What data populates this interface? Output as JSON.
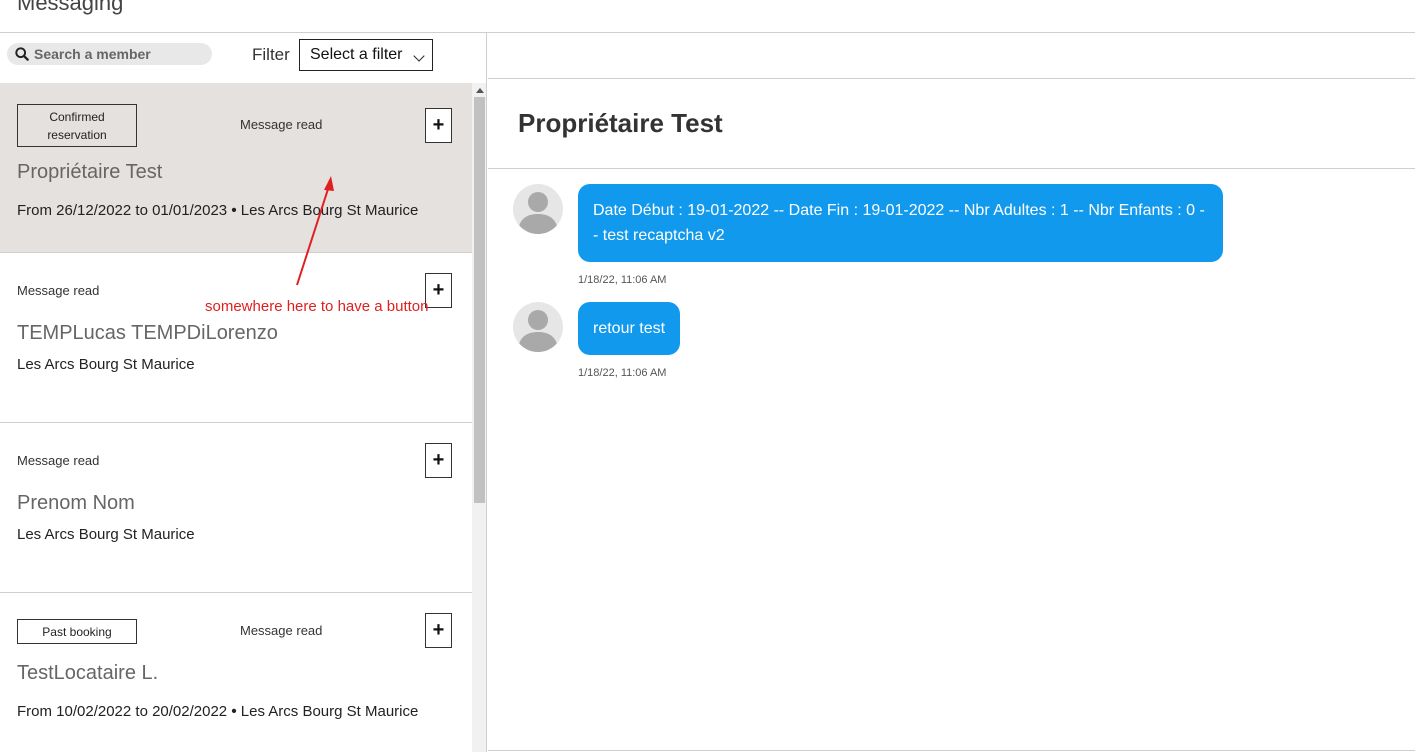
{
  "page": {
    "title": "Messaging"
  },
  "toolbar": {
    "search_placeholder": "Search a member",
    "filter_label": "Filter",
    "filter_value": "Select a filter"
  },
  "conversations": [
    {
      "tag": "Confirmed reservation",
      "status": "Message read",
      "name": "Propriétaire Test",
      "dates": "From 26/12/2022 to 01/01/2023",
      "separator": "•",
      "location": "Les Arcs Bourg St Maurice",
      "selected": true
    },
    {
      "tag": "",
      "status": "Message read",
      "name": "TEMPLucas TEMPDiLorenzo",
      "dates": "",
      "separator": "",
      "location": "Les Arcs Bourg St Maurice",
      "selected": false
    },
    {
      "tag": "",
      "status": "Message read",
      "name": "Prenom Nom",
      "dates": "",
      "separator": "",
      "location": "Les Arcs Bourg St Maurice",
      "selected": false
    },
    {
      "tag": "Past booking",
      "status": "Message read",
      "name": "TestLocataire L.",
      "dates": "From 10/02/2022 to 20/02/2022",
      "separator": "•",
      "location": "Les Arcs Bourg St Maurice",
      "selected": false
    }
  ],
  "plus_label": "+",
  "annotation": {
    "text": "somewhere here to have a button",
    "color": "#e02020"
  },
  "chat": {
    "title": "Propriétaire Test",
    "messages": [
      {
        "text": "Date Début : 19-01-2022 -- Date Fin : 19-01-2022 -- Nbr Adultes : 1 -- Nbr Enfants : 0 -- test recaptcha v2",
        "time": "1/18/22, 11:06 AM"
      },
      {
        "text": "retour test",
        "time": "1/18/22, 11:06 AM"
      }
    ]
  },
  "colors": {
    "bubble": "#1199ee",
    "selected_row": "#e4e1df",
    "annotation": "#e02020"
  },
  "icons": {
    "search": "search-icon",
    "avatar": "user-avatar-icon",
    "plus": "plus-icon",
    "chevron": "chevron-down-icon"
  }
}
